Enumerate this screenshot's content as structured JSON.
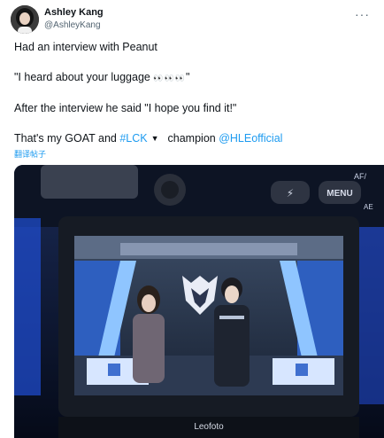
{
  "author": {
    "name": "Ashley Kang",
    "handle": "@AshleyKang",
    "more_icon": "more-horizontal-icon"
  },
  "tweet": {
    "line1": "Had an interview with Peanut",
    "line2_text": "\"I heard about your luggage ",
    "line2_emoji": "👀👀👀",
    "line2_end": "\"",
    "line3": "After the interview he said \"I hope you find it!\"",
    "line4_prefix": "That's my GOAT and ",
    "hashtag": "#LCK",
    "chevron_icon": "chevron-down-icon",
    "line4_middle": "champion ",
    "mention": "@HLEofficial",
    "translate": "翻译帖子"
  },
  "photo": {
    "camera_button_label": "MENU",
    "camera_brand": "Leofoto",
    "camera_mode_label": "AF/",
    "camera_side_label": "AE"
  },
  "colors": {
    "link": "#1d9bf0",
    "text": "#0f1419",
    "muted": "#536471"
  }
}
